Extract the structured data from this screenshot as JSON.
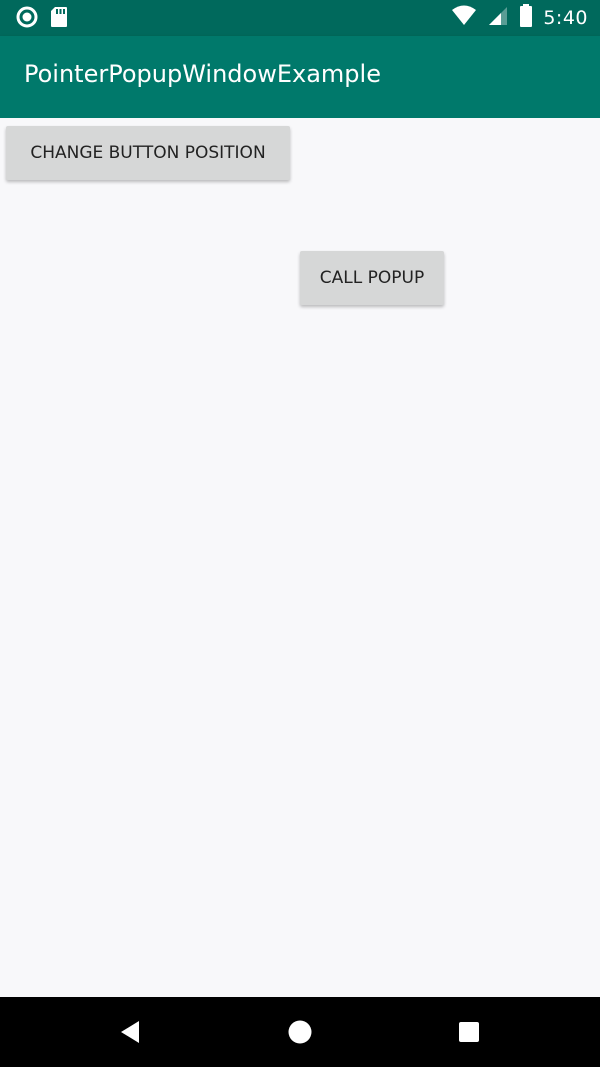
{
  "status_bar": {
    "time": "5:40",
    "icons": [
      "sync-circle-icon",
      "sd-card-icon",
      "wifi-icon",
      "signal-icon",
      "battery-icon"
    ]
  },
  "app_bar": {
    "title": "PointerPopupWindowExample",
    "color": "#00796b"
  },
  "content": {
    "change_button_label": "CHANGE BUTTON POSITION",
    "call_popup_label": "CALL POPUP"
  },
  "nav_bar": {
    "icons": [
      "back-icon",
      "home-icon",
      "recents-icon"
    ]
  },
  "colors": {
    "status_bar": "#00695c",
    "app_bar": "#00796b",
    "background": "#f8f8fa",
    "button": "#d6d7d7"
  }
}
